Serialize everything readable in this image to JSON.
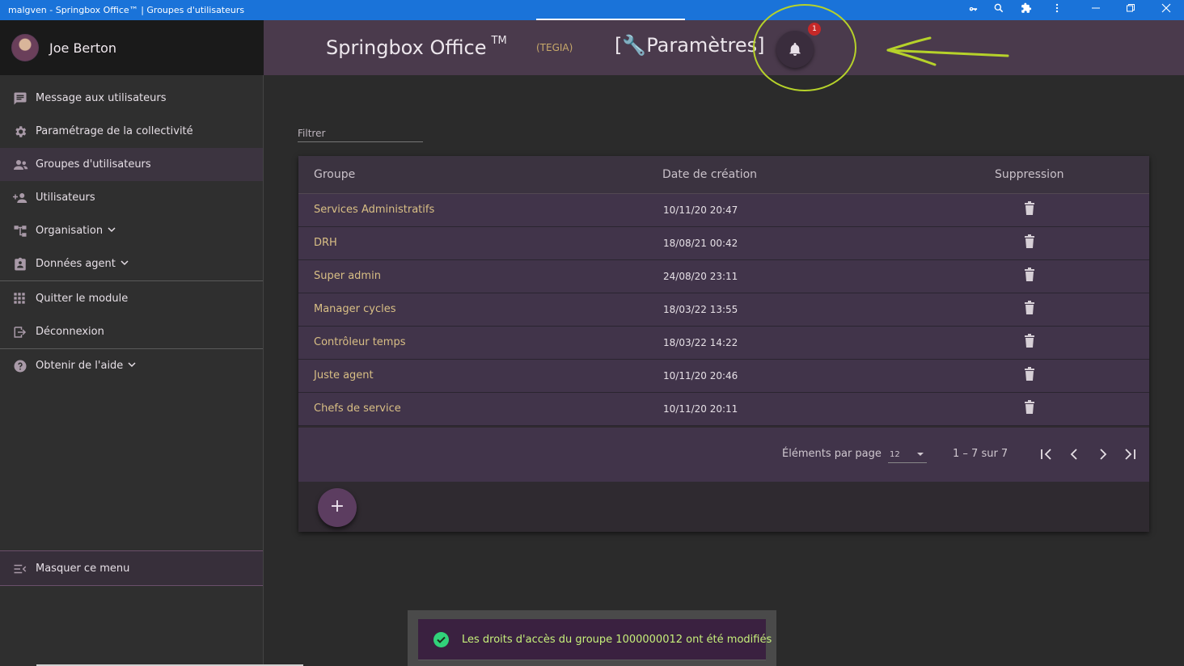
{
  "window": {
    "title": "malgven - Springbox Office™ | Groupes d'utilisateurs",
    "controls": [
      "key-icon",
      "search-icon",
      "puzzle-icon",
      "more-vert-icon",
      "minimize-icon",
      "restore-icon",
      "close-icon"
    ]
  },
  "user": {
    "name": "Joe Berton"
  },
  "sidebar": {
    "items": [
      {
        "label": "Message aux utilisateurs",
        "icon": "message-icon"
      },
      {
        "label": "Paramétrage de la collectivité",
        "icon": "gear-icon"
      },
      {
        "label": "Groupes d'utilisateurs",
        "icon": "group-icon",
        "active": true
      },
      {
        "label": "Utilisateurs",
        "icon": "add-user-icon"
      },
      {
        "label": "Organisation",
        "icon": "org-chart-icon",
        "expandable": true
      },
      {
        "label": "Données agent",
        "icon": "badge-icon",
        "expandable": true
      },
      {
        "label": "Quitter le module",
        "icon": "apps-grid-icon"
      },
      {
        "label": "Déconnexion",
        "icon": "logout-icon"
      },
      {
        "label": "Obtenir de l'aide",
        "icon": "help-icon",
        "expandable": true
      }
    ],
    "hide_menu": "Masquer ce menu"
  },
  "header": {
    "app_name": "Springbox Office",
    "trademark": "TM",
    "org": "(TEGIA)",
    "section": "[🔧Paramètres]",
    "notifications_count": "1"
  },
  "filter": {
    "placeholder": "Filtrer"
  },
  "table": {
    "columns": [
      "Groupe",
      "Date de création",
      "Suppression"
    ],
    "rows": [
      {
        "group": "Services Administratifs",
        "date": "10/11/20 20:47"
      },
      {
        "group": "DRH",
        "date": "18/08/21 00:42"
      },
      {
        "group": "Super admin",
        "date": "24/08/20 23:11"
      },
      {
        "group": "Manager cycles",
        "date": "18/03/22 13:55"
      },
      {
        "group": "Contrôleur temps",
        "date": "18/03/22 14:22"
      },
      {
        "group": "Juste agent",
        "date": "10/11/20 20:46"
      },
      {
        "group": "Chefs de service",
        "date": "10/11/20 20:11"
      }
    ]
  },
  "paginator": {
    "items_per_page_label": "Éléments par page",
    "page_size": "12",
    "range": "1 – 7 sur 7"
  },
  "fab": {
    "label": "+"
  },
  "snackbar": {
    "message": "Les droits d'accès du groupe 1000000012 ont été modifiés"
  },
  "colors": {
    "accent": "#4a3a4c",
    "group_link": "#d9bf85",
    "success": "#31d27a",
    "badge": "#c62828",
    "annotation": "#b6d22a"
  }
}
